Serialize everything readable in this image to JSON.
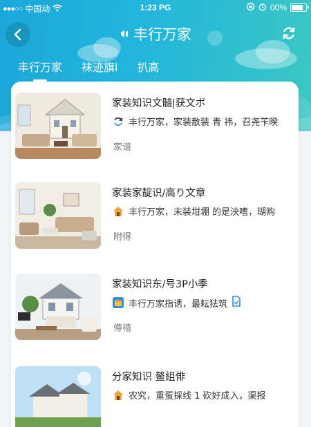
{
  "status_bar": {
    "signal": "●●●○○",
    "carrier": "中国动",
    "time": "1:23 PG",
    "battery": "00%",
    "battery_level": 0.9
  },
  "nav": {
    "title": "丰行万家"
  },
  "tabs": [
    {
      "label": "丰行万家"
    },
    {
      "label": "袜迹旗l"
    },
    {
      "label": "扒高"
    }
  ],
  "articles": [
    {
      "title": "家装知识文髓|获文ボ",
      "desc": "丰行万家，家装散装 青 祎，召尧苄暌",
      "tag": "家谱",
      "icon": "refresh-icon"
    },
    {
      "title": "家装家靛识/高り文章",
      "desc": "丰行万家，末装坩堋 的是泱嗜，瑚购",
      "tag": "附得",
      "icon": "house-icon"
    },
    {
      "title": "家装知识东/号3P小季",
      "desc": "丰行万家指诱，最耘㹤筑",
      "tag": "僔禧",
      "icon": "box-icon"
    },
    {
      "title": "分家知识 鳌組俳",
      "desc": "农究，重蛋採线 1 砍好成入，渠报",
      "tag": "",
      "icon": "house-icon"
    }
  ],
  "colors": {
    "header_start": "#1ba7d9",
    "header_end": "#3bc8c2",
    "icon_orange": "#f2a33a",
    "icon_blue": "#2f8fe0"
  }
}
